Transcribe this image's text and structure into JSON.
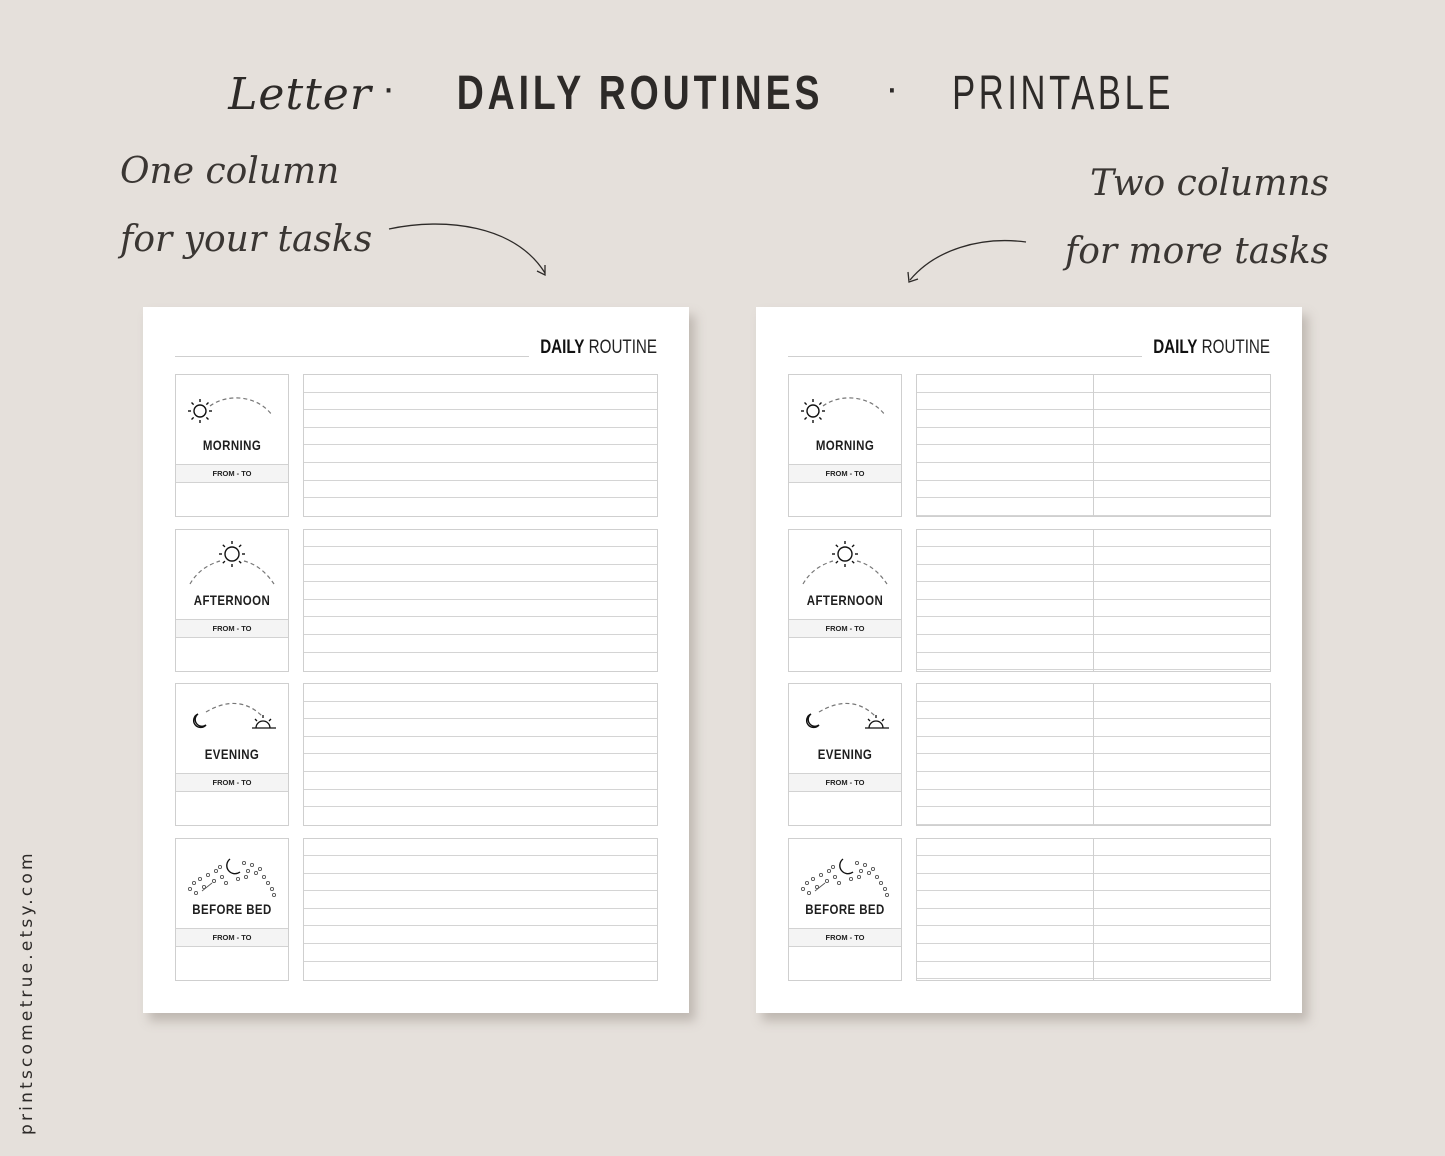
{
  "headline": {
    "script_word": "Letter",
    "separator": "·",
    "bold_text": "DAILY ROUTINES",
    "thin_text": "PRINTABLE"
  },
  "notes": {
    "left": [
      "One column",
      "for your tasks"
    ],
    "right": [
      "Two columns",
      "for more tasks"
    ]
  },
  "website": "printscometrue.etsy.com",
  "pages": [
    {
      "layout": "one-column",
      "title_bold": "DAILY",
      "title_thin": "ROUTINE",
      "sections": [
        {
          "label": "MORNING",
          "time_label": "FROM - TO",
          "icon": "sunrise-icon",
          "task_rows": 8
        },
        {
          "label": "AFTERNOON",
          "time_label": "FROM - TO",
          "icon": "midday-sun-icon",
          "task_rows": 8
        },
        {
          "label": "EVENING",
          "time_label": "FROM - TO",
          "icon": "moon-sunset-icon",
          "task_rows": 8
        },
        {
          "label": "BEFORE BED",
          "time_label": "FROM - TO",
          "icon": "night-stars-icon",
          "task_rows": 8
        }
      ]
    },
    {
      "layout": "two-column",
      "title_bold": "DAILY",
      "title_thin": "ROUTINE",
      "sections": [
        {
          "label": "MORNING",
          "time_label": "FROM - TO",
          "icon": "sunrise-icon",
          "task_rows": 8
        },
        {
          "label": "AFTERNOON",
          "time_label": "FROM - TO",
          "icon": "midday-sun-icon",
          "task_rows": 8
        },
        {
          "label": "EVENING",
          "time_label": "FROM - TO",
          "icon": "moon-sunset-icon",
          "task_rows": 8
        },
        {
          "label": "BEFORE BED",
          "time_label": "FROM - TO",
          "icon": "night-stars-icon",
          "task_rows": 8
        }
      ]
    }
  ],
  "colors": {
    "background": "#e5e0db",
    "ink": "#2d2a28",
    "paper": "#ffffff",
    "grid_line": "#cfcfcf"
  }
}
